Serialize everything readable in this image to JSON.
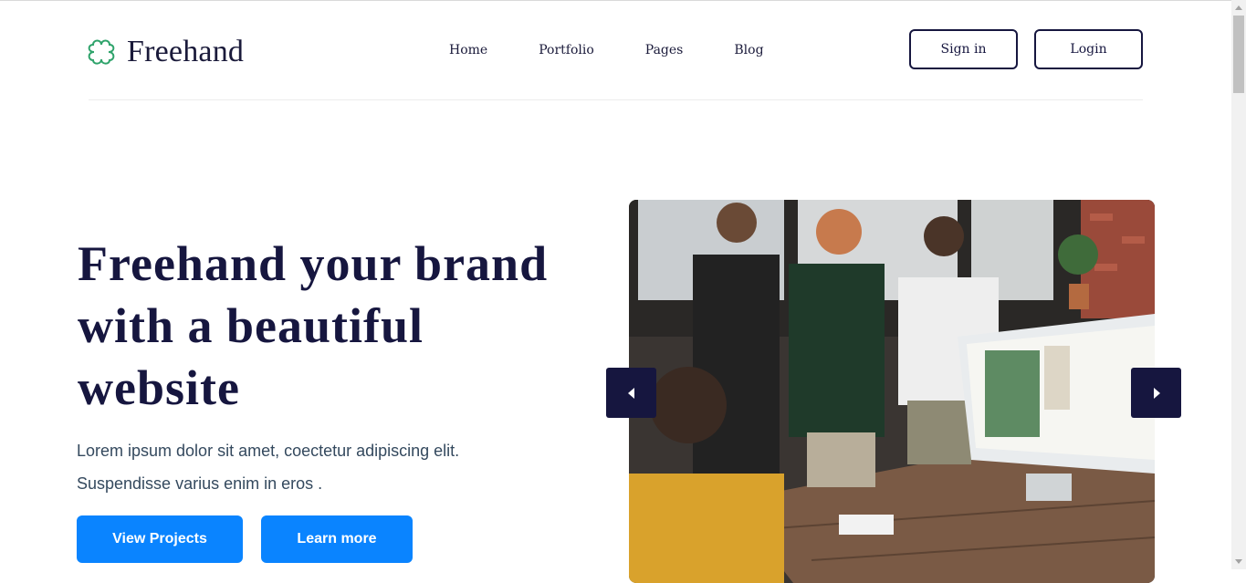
{
  "brand": {
    "name": "Freehand",
    "logo_icon": "clover-icon",
    "logo_color": "#2fa36b"
  },
  "nav": {
    "items": [
      "Home",
      "Portfolio",
      "Pages",
      "Blog"
    ],
    "sign_in": "Sign in",
    "login": "Login"
  },
  "hero": {
    "title": "Freehand your brand with a beautiful website",
    "subtitle": "Lorem ipsum dolor sit amet, coectetur adipiscing elit. Suspendisse varius enim in eros .",
    "primary_button": "View Projects",
    "secondary_button": "Learn more"
  },
  "slider": {
    "prev_icon": "caret-left-icon",
    "next_icon": "caret-right-icon"
  },
  "colors": {
    "navy": "#16163f",
    "accent": "#0a84ff",
    "text_muted": "#34495e"
  }
}
